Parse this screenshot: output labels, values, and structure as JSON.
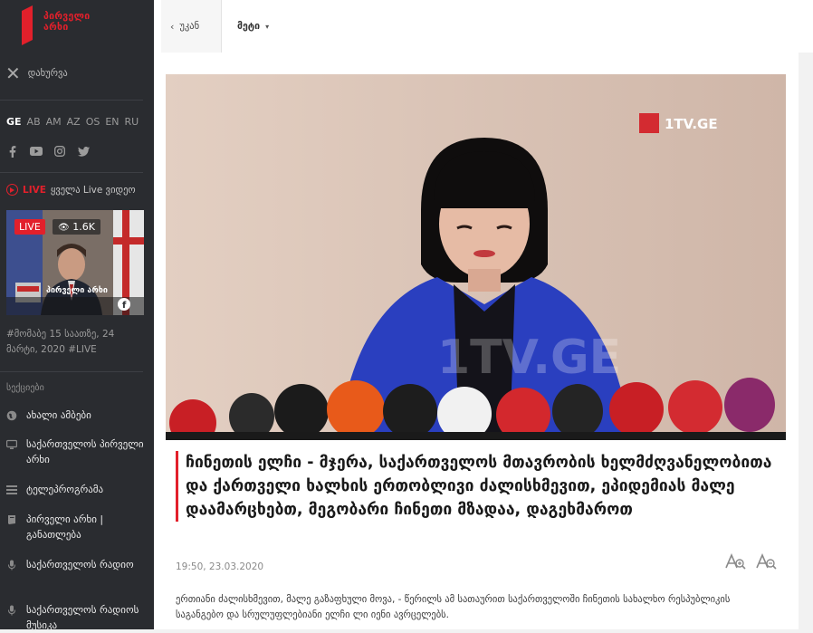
{
  "logo": {
    "line1": "პირველი",
    "line2": "არხი"
  },
  "sidebar": {
    "close_icon": "close-icon",
    "close_label": "დახურვა",
    "languages": [
      "GE",
      "AB",
      "AM",
      "AZ",
      "OS",
      "EN",
      "RU"
    ],
    "active_language": "GE",
    "socials": [
      "facebook-icon",
      "youtube-icon",
      "instagram-icon",
      "twitter-icon"
    ],
    "live_word": "LIVE",
    "live_all": "ყველა Live ვიდეო",
    "thumb": {
      "badge": "LIVE",
      "views": "1.6K",
      "channel": "პირველი არხი",
      "views_icon": "eye-icon"
    },
    "thumb_caption": "#მომაბე 15 საათზე, 24 მარტი, 2020 #LIVE",
    "sections_title": "სექციები",
    "items": [
      {
        "label": "ახალი ამბები",
        "icon": "globe-icon"
      },
      {
        "label": "საქართველოს პირველი არხი",
        "icon": "tv-icon"
      },
      {
        "label": "ტელეპროგრამა",
        "icon": "list-icon"
      },
      {
        "label": "პირველი არხი | განათლება",
        "icon": "book-icon"
      },
      {
        "label": "საქართველოს რადიო",
        "icon": "microphone-icon"
      },
      {
        "label": "საქართველოს რადიოს მუსიკა",
        "icon": "microphone-icon"
      }
    ]
  },
  "topbar": {
    "back_label": "უკან",
    "more_label": "მეტი"
  },
  "article": {
    "image_watermark": "1TV.GE",
    "headline": "ჩინეთის ელჩი - მჯერა, საქართველოს მთავრობის ხელმძღვანელობითა და ქართველი ხალხის ერთობლივი ძალისხმევით, ეპიდემიას მალე დაამარცხებთ, მეგობარი ჩინეთი მზადაა, დაგეხმაროთ",
    "date": "19:50, 23.03.2020",
    "lead": "ერთიანი ძალისხმევით, მალე გაზაფხული მოვა, - წერილს ამ სათაურით საქართველოში ჩინეთის სახალხო რესპუბლიკის საგანგებო და სრულუფლებიანი ელჩი ლი იენი ავრცელებს."
  },
  "colors": {
    "brand": "#e2202b",
    "sidebar_bg": "#2a2c30",
    "jacket": "#2a3fbf"
  }
}
